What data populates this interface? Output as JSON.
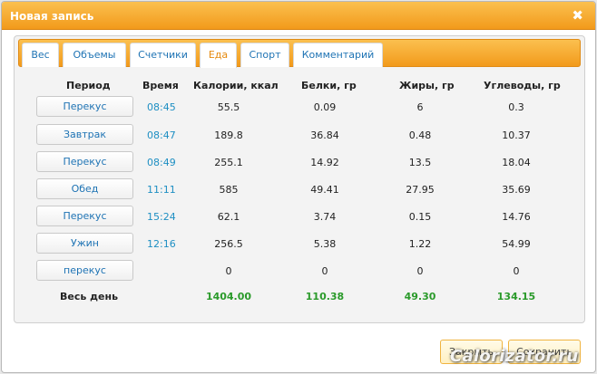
{
  "dialog": {
    "title": "Новая запись",
    "close_glyph": "✖"
  },
  "tabs": [
    {
      "label": "Вес",
      "active": false
    },
    {
      "label": "Объемы",
      "active": false
    },
    {
      "label": "Счетчики",
      "active": false
    },
    {
      "label": "Еда",
      "active": true
    },
    {
      "label": "Спорт",
      "active": false
    },
    {
      "label": "Комментарий",
      "active": false
    }
  ],
  "table": {
    "headers": {
      "period": "Период",
      "time": "Время",
      "calories": "Калории, ккал",
      "protein": "Белки, гр",
      "fat": "Жиры, гр",
      "carbs": "Углеводы, гр"
    },
    "rows": [
      {
        "period": "Перекус",
        "time": "08:45",
        "calories": "55.5",
        "protein": "0.09",
        "fat": "6",
        "carbs": "0.3"
      },
      {
        "period": "Завтрак",
        "time": "08:47",
        "calories": "189.8",
        "protein": "36.84",
        "fat": "0.48",
        "carbs": "10.37"
      },
      {
        "period": "Перекус",
        "time": "08:49",
        "calories": "255.1",
        "protein": "14.92",
        "fat": "13.5",
        "carbs": "18.04"
      },
      {
        "period": "Обед",
        "time": "11:11",
        "calories": "585",
        "protein": "49.41",
        "fat": "27.95",
        "carbs": "35.69"
      },
      {
        "period": "Перекус",
        "time": "15:24",
        "calories": "62.1",
        "protein": "3.74",
        "fat": "0.15",
        "carbs": "14.76"
      },
      {
        "period": "Ужин",
        "time": "12:16",
        "calories": "256.5",
        "protein": "5.38",
        "fat": "1.22",
        "carbs": "54.99"
      },
      {
        "period": "перекус",
        "time": "",
        "calories": "0",
        "protein": "0",
        "fat": "0",
        "carbs": "0"
      }
    ],
    "totals": {
      "label": "Весь день",
      "calories": "1404.00",
      "protein": "110.38",
      "fat": "49.30",
      "carbs": "134.15"
    }
  },
  "footer": {
    "close_label": "Закрыть",
    "save_label": "Сохранить"
  },
  "watermark": "Calorizator.ru",
  "colors": {
    "accent_orange": "#f29a1b",
    "link_blue": "#1e73b4",
    "total_green": "#2a9a2a"
  }
}
